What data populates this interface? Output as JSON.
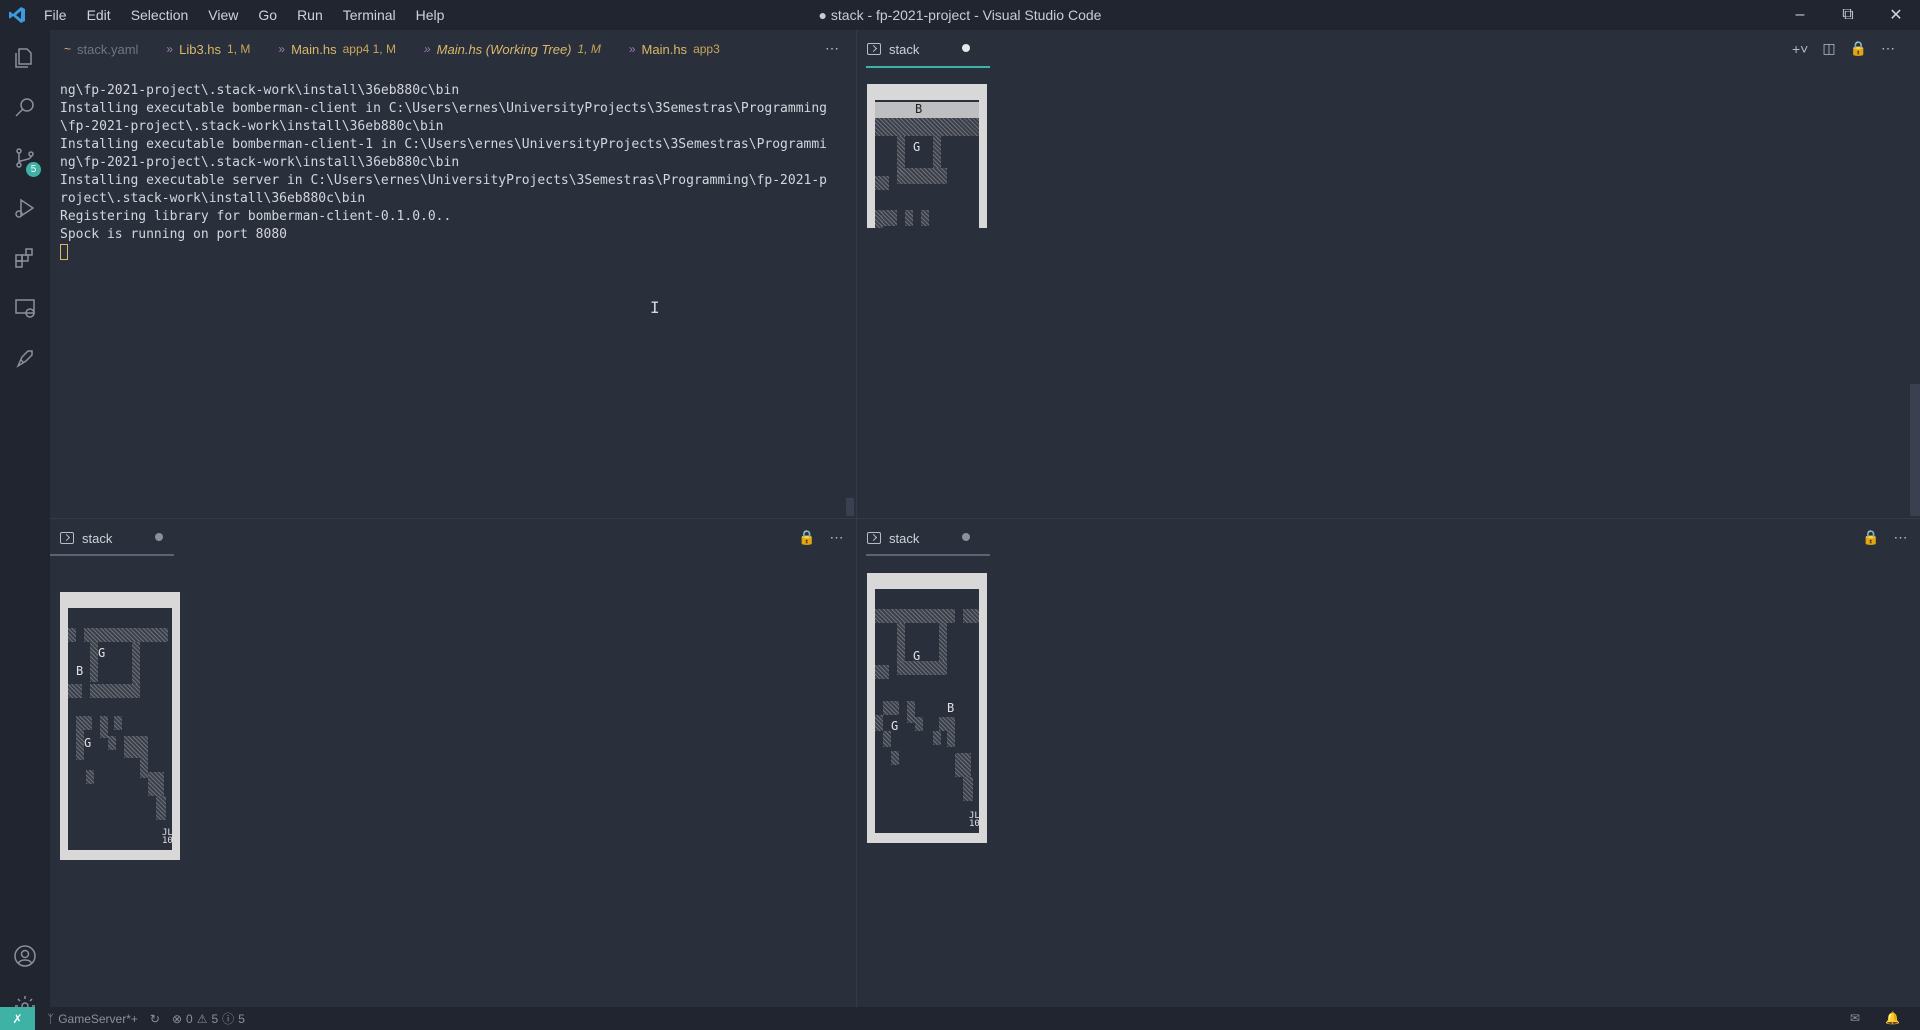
{
  "window": {
    "title": "● stack - fp-2021-project - Visual Studio Code"
  },
  "menu": [
    "File",
    "Edit",
    "Selection",
    "View",
    "Go",
    "Run",
    "Terminal",
    "Help"
  ],
  "editor_tabs": [
    {
      "label": "stack.yaml",
      "meta": "",
      "mark": "yaml-icon"
    },
    {
      "label": "Lib3.hs",
      "meta": "1, M",
      "mark": "haskell-icon"
    },
    {
      "label": "Main.hs",
      "meta": "app4  1, M",
      "mark": "haskell-icon"
    },
    {
      "label": "Main.hs (Working Tree)",
      "meta": "1, M",
      "mark": "haskell-icon"
    },
    {
      "label": "Main.hs",
      "meta": "app3",
      "mark": "haskell-icon"
    }
  ],
  "terminal_main": {
    "lines": [
      "ng\\fp-2021-project\\.stack-work\\install\\36eb880c\\bin",
      "Installing executable bomberman-client in C:\\Users\\ernes\\UniversityProjects\\3Semestras\\Programming",
      "\\fp-2021-project\\.stack-work\\install\\36eb880c\\bin",
      "Installing executable bomberman-client-1 in C:\\Users\\ernes\\UniversityProjects\\3Semestras\\Programmi",
      "ng\\fp-2021-project\\.stack-work\\install\\36eb880c\\bin",
      "Installing executable server in C:\\Users\\ernes\\UniversityProjects\\3Semestras\\Programming\\fp-2021-p",
      "roject\\.stack-work\\install\\36eb880c\\bin",
      "Registering library for bomberman-client-0.1.0.0..",
      "Spock is running on port 8080"
    ]
  },
  "terminal_tabs": {
    "top_right": "stack",
    "bottom_left": "stack",
    "bottom_right": "stack"
  },
  "boards": {
    "top_right": {
      "labels": [
        "B",
        "G"
      ]
    },
    "bottom_left": {
      "labels": [
        "G",
        "B",
        "G",
        "JL",
        "10"
      ]
    },
    "bottom_right": {
      "labels": [
        "G",
        "B",
        "G",
        "JL",
        "10"
      ]
    }
  },
  "statusbar": {
    "branch": "GameServer*+",
    "errors": "0",
    "warnings": "5",
    "info": "5"
  },
  "colors": {
    "accent": "#3fb2a6",
    "modified": "#d9b86a",
    "background": "#2a2f3c"
  }
}
